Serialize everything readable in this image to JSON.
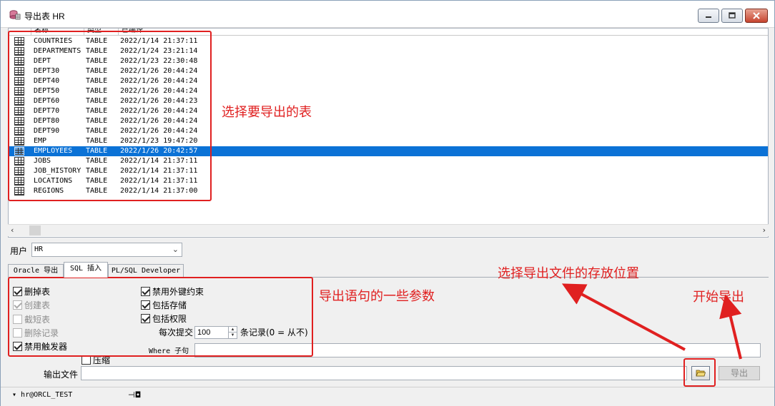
{
  "window": {
    "title": "导出表 HR",
    "controls": {
      "minimize": "▭",
      "maximize": "▢",
      "close": "✕"
    }
  },
  "list": {
    "columns": [
      "名称",
      "类型",
      "已编译"
    ],
    "rows": [
      {
        "name": "COUNTRIES",
        "type": "TABLE",
        "compiled": "2022/1/14 21:37:11"
      },
      {
        "name": "DEPARTMENTS",
        "type": "TABLE",
        "compiled": "2022/1/24 23:21:14"
      },
      {
        "name": "DEPT",
        "type": "TABLE",
        "compiled": "2022/1/23 22:30:48"
      },
      {
        "name": "DEPT30",
        "type": "TABLE",
        "compiled": "2022/1/26 20:44:24"
      },
      {
        "name": "DEPT40",
        "type": "TABLE",
        "compiled": "2022/1/26 20:44:24"
      },
      {
        "name": "DEPT50",
        "type": "TABLE",
        "compiled": "2022/1/26 20:44:24"
      },
      {
        "name": "DEPT60",
        "type": "TABLE",
        "compiled": "2022/1/26 20:44:23"
      },
      {
        "name": "DEPT70",
        "type": "TABLE",
        "compiled": "2022/1/26 20:44:24"
      },
      {
        "name": "DEPT80",
        "type": "TABLE",
        "compiled": "2022/1/26 20:44:24"
      },
      {
        "name": "DEPT90",
        "type": "TABLE",
        "compiled": "2022/1/26 20:44:24"
      },
      {
        "name": "EMP",
        "type": "TABLE",
        "compiled": "2022/1/23 19:47:20"
      },
      {
        "name": "EMPLOYEES",
        "type": "TABLE",
        "compiled": "2022/1/26 20:42:57",
        "selected": true
      },
      {
        "name": "JOBS",
        "type": "TABLE",
        "compiled": "2022/1/14 21:37:11"
      },
      {
        "name": "JOB_HISTORY",
        "type": "TABLE",
        "compiled": "2022/1/14 21:37:11"
      },
      {
        "name": "LOCATIONS",
        "type": "TABLE",
        "compiled": "2022/1/14 21:37:11"
      },
      {
        "name": "REGIONS",
        "type": "TABLE",
        "compiled": "2022/1/14 21:37:00"
      }
    ]
  },
  "user": {
    "label": "用户",
    "value": "HR"
  },
  "tabs": [
    {
      "label": "Oracle 导出",
      "active": false
    },
    {
      "label": "SQL 插入",
      "active": true
    },
    {
      "label": "PL/SQL Developer",
      "active": false
    }
  ],
  "options": {
    "drop_tables": {
      "label": "删掉表",
      "checked": true,
      "disabled": false
    },
    "create_tables": {
      "label": "创建表",
      "checked": true,
      "disabled": true
    },
    "truncate_tables": {
      "label": "截短表",
      "checked": false,
      "disabled": true
    },
    "delete_records": {
      "label": "删除记录",
      "checked": false,
      "disabled": true
    },
    "disable_triggers": {
      "label": "禁用触发器",
      "checked": true,
      "disabled": false
    },
    "disable_fk": {
      "label": "禁用外键约束",
      "checked": true,
      "disabled": false
    },
    "include_storage": {
      "label": "包括存储",
      "checked": true,
      "disabled": false
    },
    "include_privileges": {
      "label": "包括权限",
      "checked": true,
      "disabled": false
    },
    "compress": {
      "label": "压缩",
      "checked": false,
      "disabled": false
    }
  },
  "commit": {
    "label": "每次提交",
    "value": "100",
    "suffix": "条记录(0 = 从不)"
  },
  "where": {
    "label": "Where 子句",
    "value": ""
  },
  "output": {
    "label": "输出文件",
    "value": "",
    "export_label": "导出"
  },
  "status": {
    "connection": "hr@ORCL_TEST"
  },
  "annotations": {
    "select_tables": "选择要导出的表",
    "export_params": "导出语句的一些参数",
    "choose_location": "选择导出文件的存放位置",
    "start_export": "开始导出",
    "color": "#e02020"
  },
  "colors": {
    "selection": "#0b72d6"
  }
}
